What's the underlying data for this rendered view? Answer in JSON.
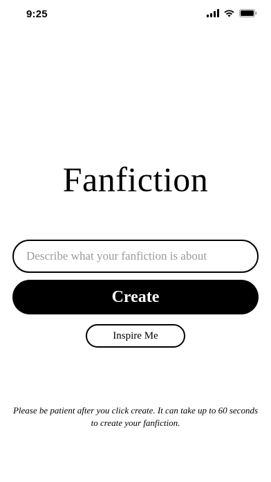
{
  "status_bar": {
    "time": "9:25",
    "icons": [
      "signal-icon",
      "wifi-icon",
      "battery-icon"
    ]
  },
  "main": {
    "title": "Fanfiction",
    "prompt_input": {
      "value": "",
      "placeholder": "Describe what your fanfiction is about"
    },
    "create_label": "Create",
    "inspire_label": "Inspire Me",
    "notice": "Please be patient after you click create. It can take up to 60 seconds to create your fanfiction."
  },
  "colors": {
    "background": "#ffffff",
    "primary": "#000000",
    "placeholder": "#9a9a9a"
  }
}
